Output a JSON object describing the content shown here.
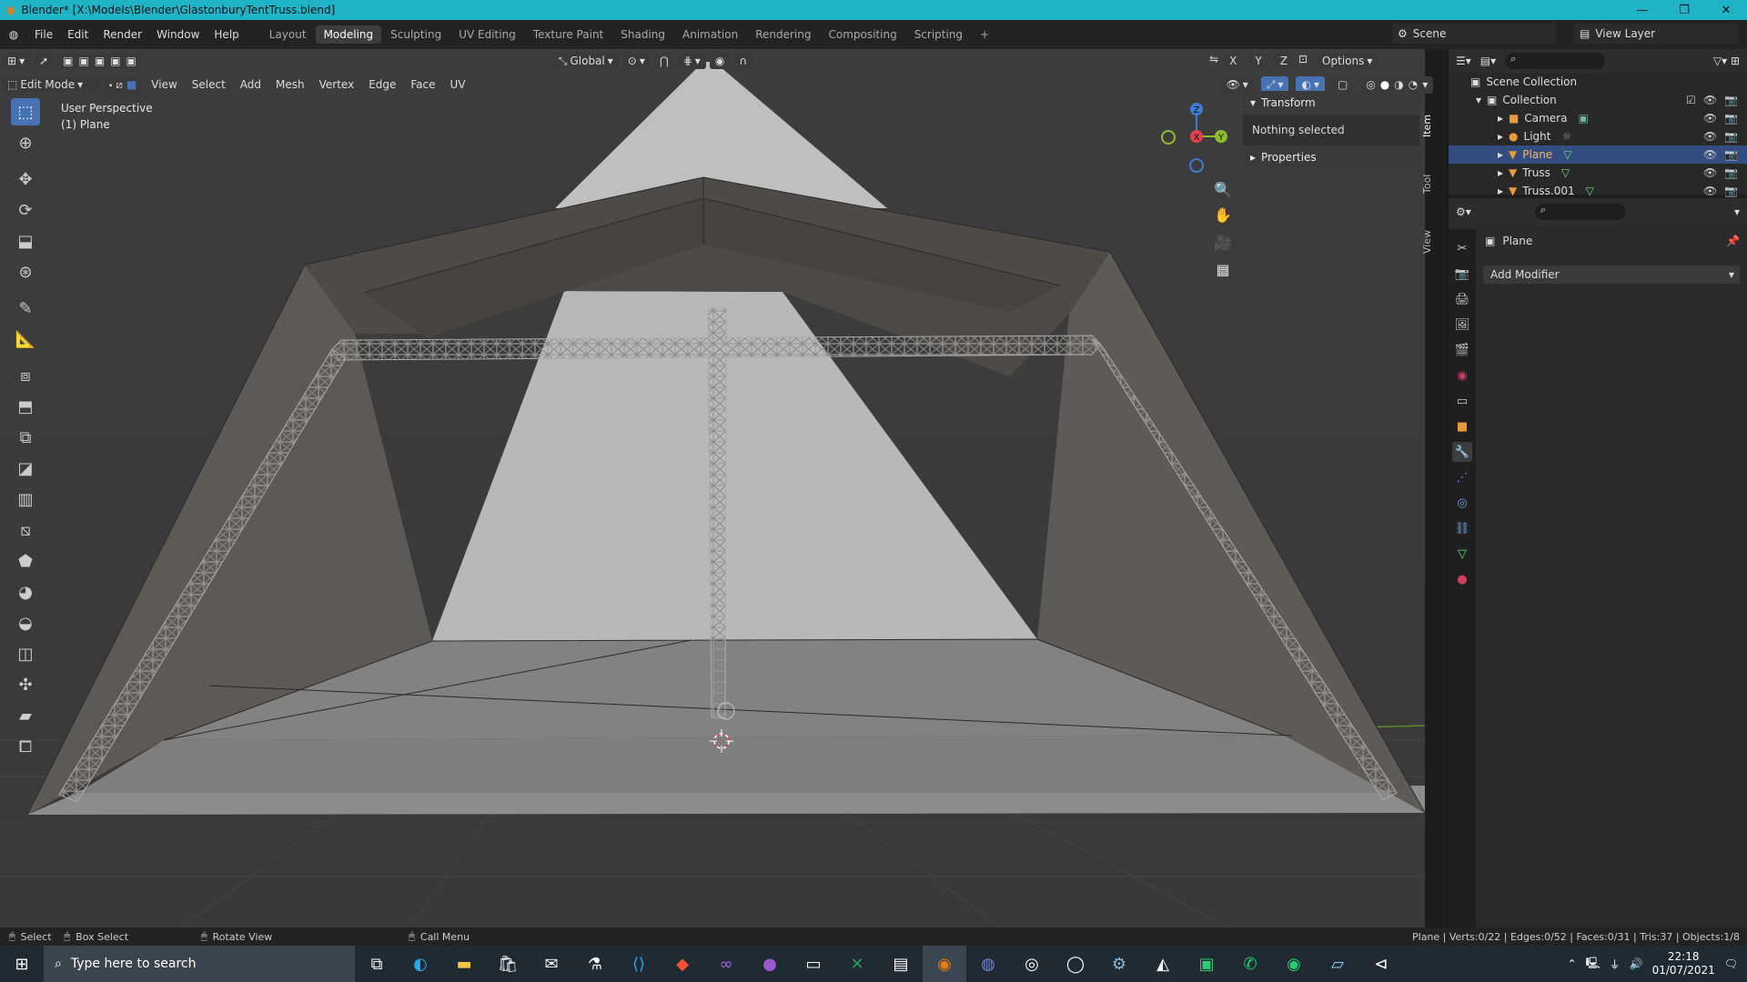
{
  "window": {
    "title": "Blender* [X:\\Models\\Blender\\GlastonburyTentTruss.blend]",
    "controls": [
      "—",
      "❐",
      "✕"
    ]
  },
  "menus": [
    "File",
    "Edit",
    "Render",
    "Window",
    "Help"
  ],
  "workspaces": [
    "Layout",
    "Modeling",
    "Sculpting",
    "UV Editing",
    "Texture Paint",
    "Shading",
    "Animation",
    "Rendering",
    "Compositing",
    "Scripting",
    "+"
  ],
  "active_workspace": "Modeling",
  "scene": {
    "label": "Scene"
  },
  "view_layer": {
    "label": "View Layer"
  },
  "viewport": {
    "mode": "Edit Mode",
    "header_menus": [
      "View",
      "Select",
      "Add",
      "Mesh",
      "Vertex",
      "Edge",
      "Face",
      "UV"
    ],
    "orientation": "Global",
    "options_label": "Options",
    "axis_labels": [
      "X",
      "Y",
      "Z"
    ],
    "perspective": "User Perspective",
    "object_label": "(1) Plane"
  },
  "npanel": {
    "transform_label": "Transform",
    "nothing_selected": "Nothing selected",
    "properties_label": "Properties",
    "tabs": [
      "Item",
      "Tool",
      "View"
    ]
  },
  "gizmo": {
    "x": "X",
    "y": "Y",
    "z": "Z"
  },
  "outliner": {
    "root": "Scene Collection",
    "collection": "Collection",
    "items": [
      {
        "name": "Camera",
        "selected": false
      },
      {
        "name": "Light",
        "selected": false
      },
      {
        "name": "Plane",
        "selected": true
      },
      {
        "name": "Truss",
        "selected": false
      },
      {
        "name": "Truss.001",
        "selected": false
      }
    ]
  },
  "properties": {
    "object": "Plane",
    "add_modifier": "Add Modifier"
  },
  "statusbar": {
    "select": "Select",
    "box_select": "Box Select",
    "rotate_view": "Rotate View",
    "call_menu": "Call Menu",
    "stats": "Plane | Verts:0/22 | Edges:0/52 | Faces:0/31 | Tris:37 | Objects:1/8"
  },
  "taskbar": {
    "search_placeholder": "Type here to search",
    "time": "22:18",
    "date": "01/07/2021"
  },
  "colors": {
    "titlebar": "#1fb3c7",
    "accent": "#4772b3",
    "x_axis": "#e0434b",
    "y_axis": "#8dbe2c",
    "z_axis": "#3d7bd7"
  }
}
